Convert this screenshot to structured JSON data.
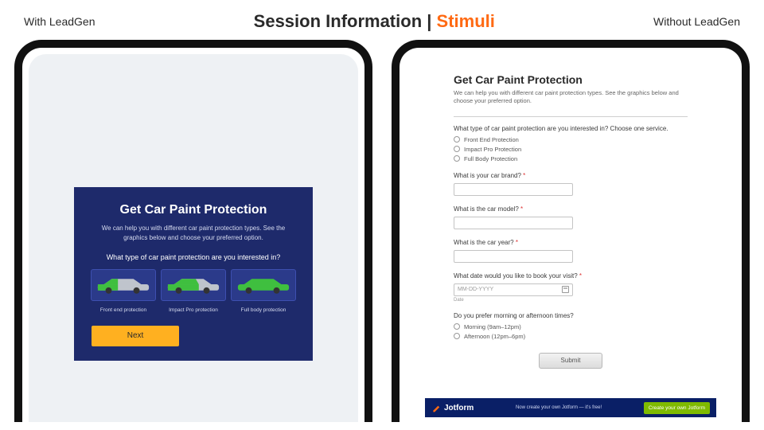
{
  "header": {
    "left_label": "With LeadGen",
    "title_main": "Session Information",
    "title_sep": " | ",
    "title_accent": "Stimuli",
    "right_label": "Without LeadGen"
  },
  "leadgen_form": {
    "title": "Get Car Paint Protection",
    "subtitle": "We can help you with different car paint protection types. See the graphics below and choose your preferred option.",
    "question": "What type of car paint protection are you interested in?",
    "options": [
      {
        "label": "Front end protection"
      },
      {
        "label": "Impact Pro protection"
      },
      {
        "label": "Full body protection"
      }
    ],
    "next_label": "Next"
  },
  "jotform_form": {
    "title": "Get Car Paint Protection",
    "subtitle": "We can help you with different car paint protection types. See the graphics below and choose your preferred option.",
    "q1": {
      "label": "What type of car paint protection are you interested in? Choose one service.",
      "options": [
        "Front End Protection",
        "Impact Pro Protection",
        "Full Body Protection"
      ]
    },
    "q2_label": "What is your car brand?",
    "q3_label": "What is the car model?",
    "q4_label": "What is the car year?",
    "q5_label": "What date would you like to book your visit?",
    "date_placeholder": "MM-DD-YYYY",
    "date_hint": "Date",
    "q6": {
      "label": "Do you prefer morning or afternoon times?",
      "options": [
        "Morning (9am–12pm)",
        "Afternoon (12pm–6pm)"
      ]
    },
    "submit_label": "Submit",
    "required_mark": "*",
    "footer": {
      "brand": "Jotform",
      "tagline": "Now create your own Jotform — it's free!",
      "cta": "Create your own Jotform"
    }
  }
}
